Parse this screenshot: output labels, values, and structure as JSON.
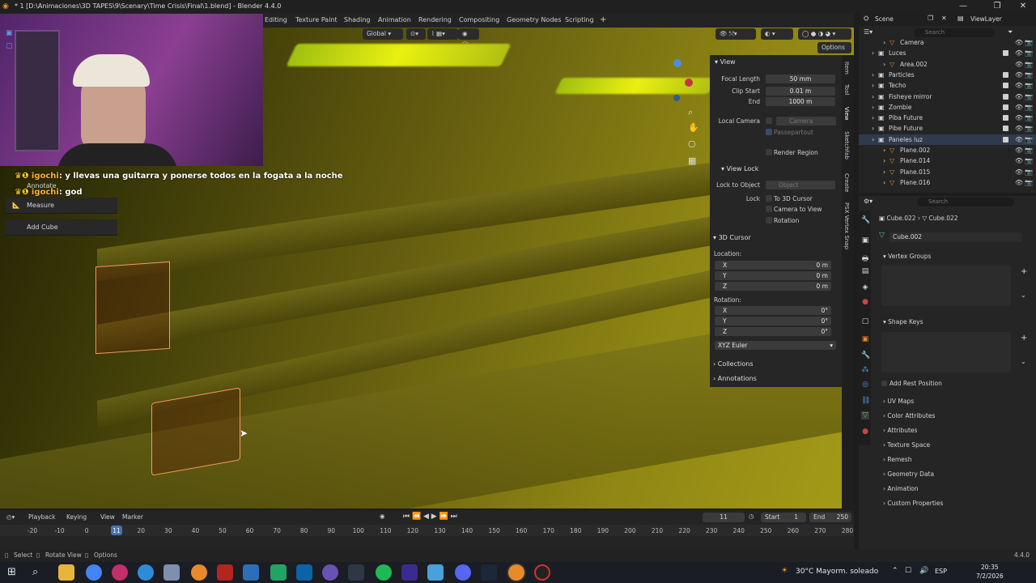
{
  "app": {
    "title": "* 1 [D:\\Animaciones\\3D TAPES\\9\\Scenary\\Time Crisis\\Final\\1.blend] - Blender 4.4.0",
    "version": "4.4.0"
  },
  "workspace_tabs": [
    "Editing",
    "Texture Paint",
    "Shading",
    "Animation",
    "Rendering",
    "Compositing",
    "Geometry Nodes",
    "Scripting",
    "+"
  ],
  "viewport_header": {
    "orientation": "Global",
    "options_label": "Options"
  },
  "chat": [
    {
      "user": "igochi",
      "message": "y llevas una guitarra y ponerse todos en la fogata a la noche"
    },
    {
      "user": "igochi",
      "message": "god"
    }
  ],
  "tool_popup": {
    "items": [
      "Annotate",
      "Measure",
      "Add Cube"
    ]
  },
  "n_panel": {
    "tabs": [
      "Item",
      "Tool",
      "View",
      "Sketchfab",
      "Create",
      "PSX Vertex Snap"
    ],
    "view": {
      "header": "View",
      "focal_length_label": "Focal Length",
      "focal_length": "50 mm",
      "clip_start_label": "Clip Start",
      "clip_start": "0.01 m",
      "end_label": "End",
      "end": "1000 m",
      "local_camera_label": "Local Camera",
      "local_camera_value": "Camera",
      "passepartout": "Passepartout",
      "render_region": "Render Region"
    },
    "view_lock": {
      "header": "View Lock",
      "lock_to_object_label": "Lock to Object",
      "lock_to_object_placeholder": "Object",
      "lock_label": "Lock",
      "to_3d_cursor": "To 3D Cursor",
      "camera_to_view": "Camera to View",
      "rotation": "Rotation"
    },
    "cursor": {
      "header": "3D Cursor",
      "location_label": "Location:",
      "x_label": "X",
      "y_label": "Y",
      "z_label": "Z",
      "loc_x": "0 m",
      "loc_y": "0 m",
      "loc_z": "0 m",
      "rotation_label": "Rotation:",
      "rot_x": "0°",
      "rot_y": "0°",
      "rot_z": "0°",
      "mode": "XYZ Euler"
    },
    "collections": "Collections",
    "annotations": "Annotations"
  },
  "outliner": {
    "scene_label": "Scene",
    "viewlayer_label": "ViewLayer",
    "search_placeholder": "Search",
    "rows": [
      {
        "name": "Camera",
        "indent": 1
      },
      {
        "name": "Luces",
        "indent": 0
      },
      {
        "name": "Area.002",
        "indent": 1
      },
      {
        "name": "Particles",
        "indent": 0
      },
      {
        "name": "Techo",
        "indent": 0
      },
      {
        "name": "Fisheye mirror",
        "indent": 0
      },
      {
        "name": "Zombie",
        "indent": 0
      },
      {
        "name": "Piba Future",
        "indent": 0
      },
      {
        "name": "Pibe Future",
        "indent": 0
      },
      {
        "name": "Paneles luz",
        "indent": 0
      },
      {
        "name": "Plane.002",
        "indent": 1
      },
      {
        "name": "Plane.014",
        "indent": 1
      },
      {
        "name": "Plane.015",
        "indent": 1
      },
      {
        "name": "Plane.016",
        "indent": 1
      }
    ]
  },
  "properties": {
    "search_placeholder": "Search",
    "breadcrumb_object": "Cube.022",
    "breadcrumb_mesh": "Cube.022",
    "data_name": "Cube.002",
    "sections": {
      "vertex_groups": "Vertex Groups",
      "shape_keys": "Shape Keys",
      "add_rest_position": "Add Rest Position",
      "uv_maps": "UV Maps",
      "color_attributes": "Color Attributes",
      "attributes": "Attributes",
      "texture_space": "Texture Space",
      "remesh": "Remesh",
      "geometry_data": "Geometry Data",
      "animation": "Animation",
      "custom_properties": "Custom Properties"
    }
  },
  "timeline": {
    "menus": [
      "Playback",
      "Keying",
      "View",
      "Marker"
    ],
    "current_frame": "11",
    "start_label": "Start",
    "start": "1",
    "end_label": "End",
    "end": "250",
    "ticks": [
      "-20",
      "-10",
      "0",
      "11",
      "20",
      "30",
      "40",
      "50",
      "60",
      "70",
      "80",
      "90",
      "100",
      "110",
      "120",
      "130",
      "140",
      "150",
      "160",
      "170",
      "180",
      "190",
      "200",
      "210",
      "220",
      "230",
      "240",
      "250",
      "260",
      "270",
      "280"
    ],
    "tick_values": [
      -20,
      -10,
      0,
      11,
      20,
      30,
      40,
      50,
      60,
      70,
      80,
      90,
      100,
      110,
      120,
      130,
      140,
      150,
      160,
      170,
      180,
      190,
      200,
      210,
      220,
      230,
      240,
      250,
      260,
      270,
      280
    ]
  },
  "statusbar": {
    "select": "Select",
    "rotate_view": "Rotate View",
    "options": "Options"
  },
  "taskbar": {
    "weather": "30°C  Mayorm. soleado",
    "lang": "ESP",
    "time": "20:35",
    "date": "7/2/2026"
  },
  "colors": {
    "accent": "#4772b3",
    "selection_outline": "#f59a62",
    "chat_user": "#ffb23a"
  }
}
